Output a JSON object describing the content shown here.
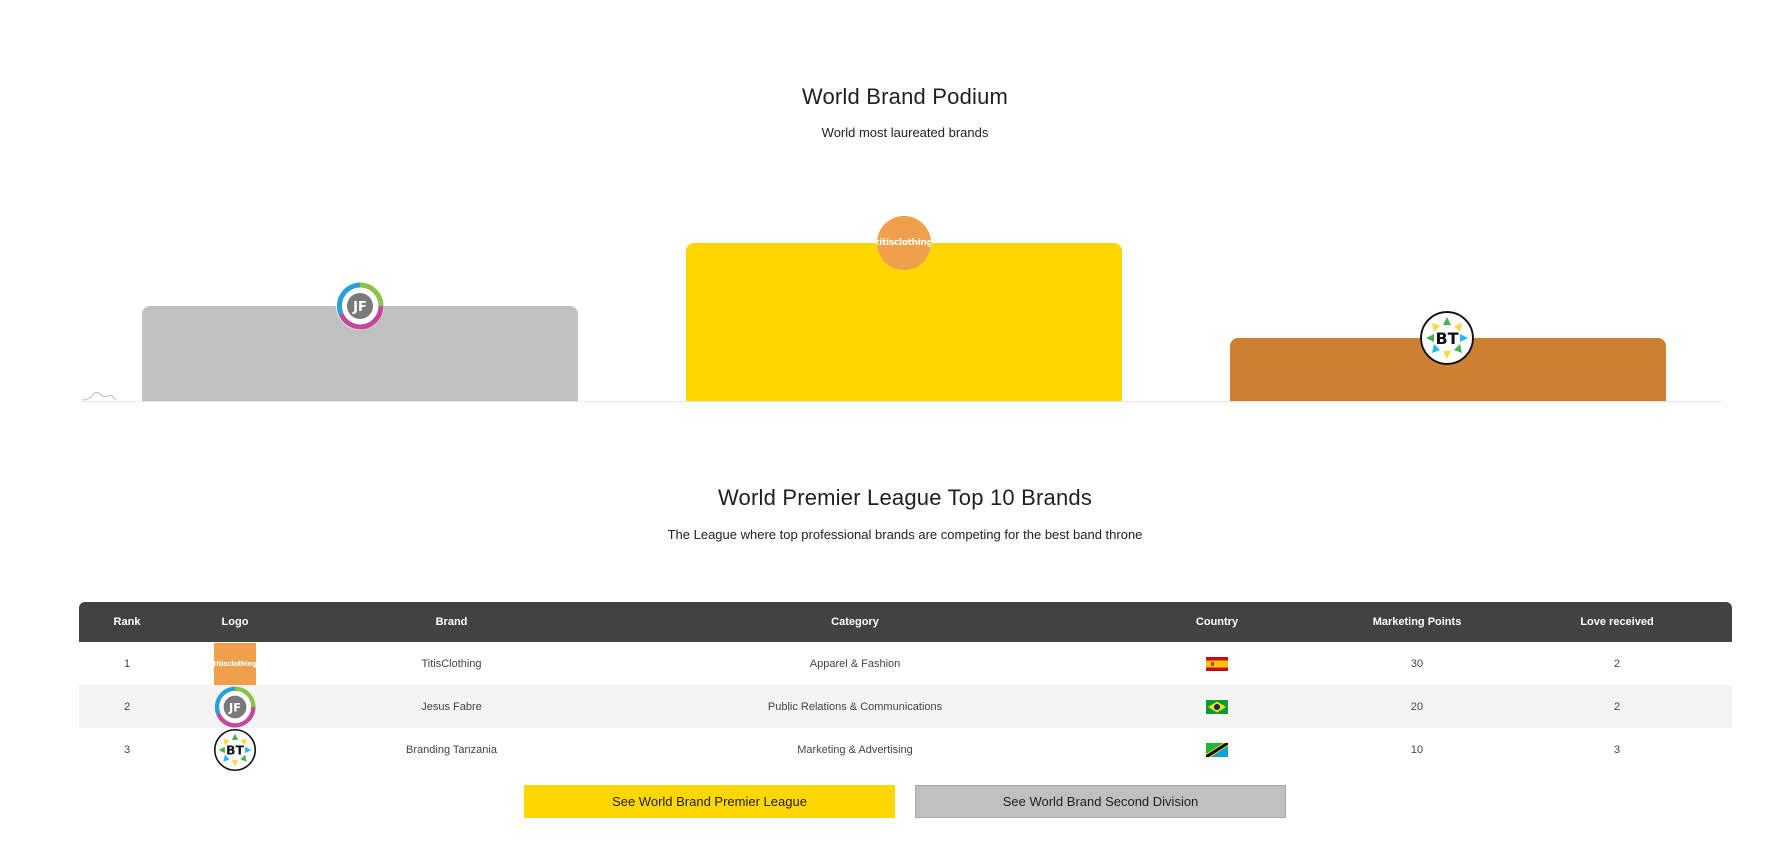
{
  "podium": {
    "title": "World Brand Podium",
    "subtitle": "World most laureated brands",
    "places": [
      {
        "rank": 2,
        "brand": "Jesus Fabre",
        "color": "#c0c0c0",
        "logo_initials": "JF"
      },
      {
        "rank": 1,
        "brand": "TitisClothing",
        "color": "#ffd700",
        "logo_text": "titisclothing"
      },
      {
        "rank": 3,
        "brand": "Branding Tanzania",
        "color": "#cd7f32",
        "logo_initials": "BT"
      }
    ]
  },
  "league": {
    "title": "World Premier League Top 10 Brands",
    "subtitle": "The League where top professional brands are competing for the best band throne",
    "columns": [
      "Rank",
      "Logo",
      "Brand",
      "Category",
      "Country",
      "Marketing Points",
      "Love received"
    ],
    "rows": [
      {
        "rank": "1",
        "logo": "titisclothing-logo",
        "brand": "TitisClothing",
        "category": "Apparel & Fashion",
        "country": "Spain",
        "points": "30",
        "love": "2"
      },
      {
        "rank": "2",
        "logo": "jesus-fabre-logo",
        "brand": "Jesus Fabre",
        "category": "Public Relations & Communications",
        "country": "Brazil",
        "points": "20",
        "love": "2"
      },
      {
        "rank": "3",
        "logo": "branding-tanzania-logo",
        "brand": "Branding Tanzania",
        "category": "Marketing & Advertising",
        "country": "Tanzania",
        "points": "10",
        "love": "3"
      }
    ]
  },
  "buttons": {
    "premier": "See World Brand Premier League",
    "second": "See World Brand Second Division"
  },
  "logos": {
    "titis_text": "titisclothing",
    "jf_initials": "JF",
    "bt_initials": "BT"
  }
}
